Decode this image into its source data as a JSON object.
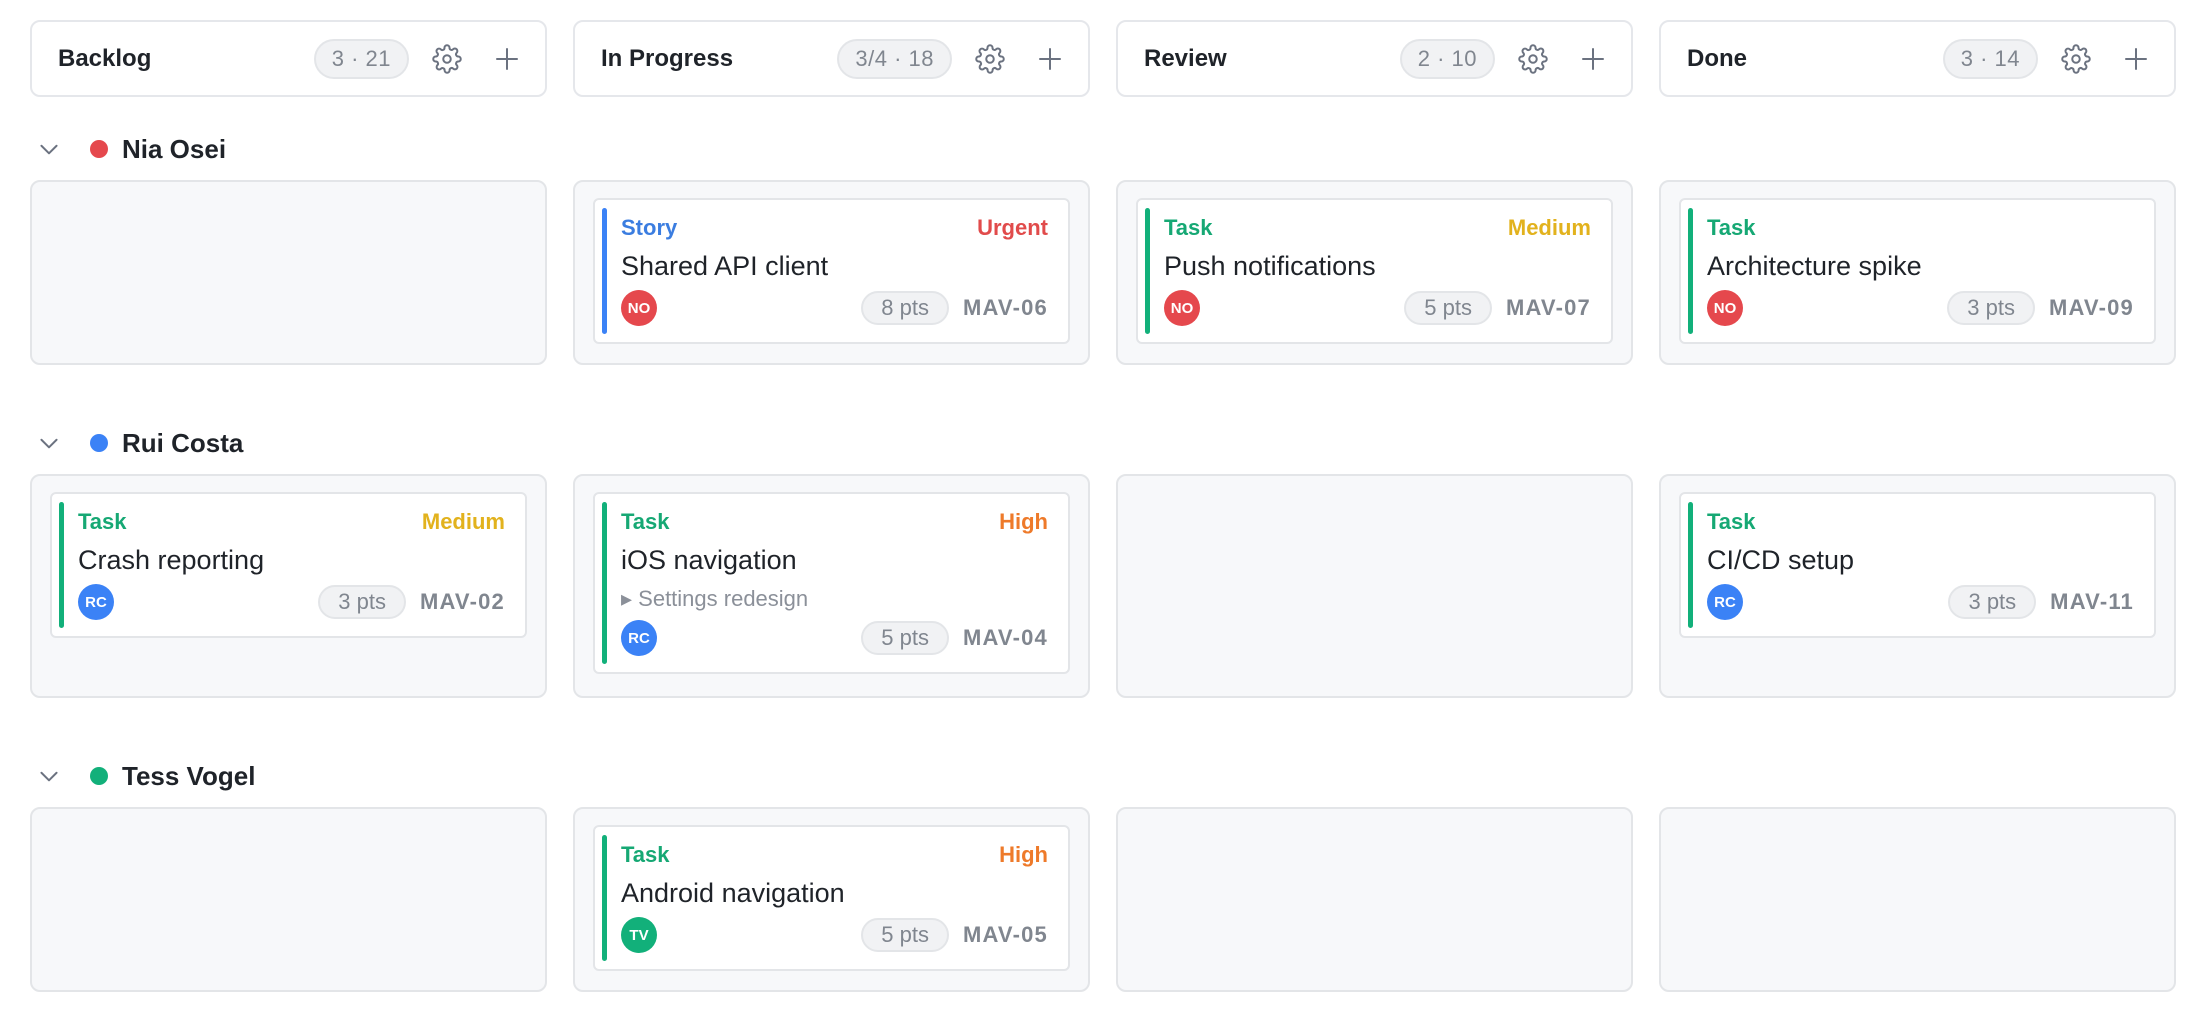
{
  "columns": [
    {
      "title": "Backlog",
      "count": "3 · 21"
    },
    {
      "title": "In Progress",
      "count": "3/4 · 18"
    },
    {
      "title": "Review",
      "count": "2 · 10"
    },
    {
      "title": "Done",
      "count": "3 · 14"
    }
  ],
  "colors": {
    "red": "#e5484d",
    "blue": "#3b82f6",
    "green": "#12b07a",
    "story": "#3b7de0",
    "task": "#16a874",
    "urgent": "#e14b4b",
    "high": "#ee7a2a",
    "medium": "#e2b21d"
  },
  "lanes": [
    {
      "name": "Nia Osei",
      "color": "#e5484d",
      "cells": [
        [],
        [
          {
            "type": "Story",
            "priority": "Urgent",
            "title": "Shared API client",
            "parent": "",
            "avatar": "NO",
            "points": "8 pts",
            "key": "MAV-06"
          }
        ],
        [
          {
            "type": "Task",
            "priority": "Medium",
            "title": "Push notifications",
            "parent": "",
            "avatar": "NO",
            "points": "5 pts",
            "key": "MAV-07"
          }
        ],
        [
          {
            "type": "Task",
            "priority": "",
            "title": "Architecture spike",
            "parent": "",
            "avatar": "NO",
            "points": "3 pts",
            "key": "MAV-09"
          }
        ]
      ]
    },
    {
      "name": "Rui Costa",
      "color": "#3b82f6",
      "cells": [
        [
          {
            "type": "Task",
            "priority": "Medium",
            "title": "Crash reporting",
            "parent": "",
            "avatar": "RC",
            "points": "3 pts",
            "key": "MAV-02"
          }
        ],
        [
          {
            "type": "Task",
            "priority": "High",
            "title": "iOS navigation",
            "parent": "▸ Settings redesign",
            "avatar": "RC",
            "points": "5 pts",
            "key": "MAV-04"
          }
        ],
        [],
        [
          {
            "type": "Task",
            "priority": "",
            "title": "CI/CD setup",
            "parent": "",
            "avatar": "RC",
            "points": "3 pts",
            "key": "MAV-11"
          }
        ]
      ]
    },
    {
      "name": "Tess Vogel",
      "color": "#12b07a",
      "cells": [
        [],
        [
          {
            "type": "Task",
            "priority": "High",
            "title": "Android navigation",
            "parent": "",
            "avatar": "TV",
            "points": "5 pts",
            "key": "MAV-05"
          }
        ],
        [],
        []
      ]
    }
  ]
}
